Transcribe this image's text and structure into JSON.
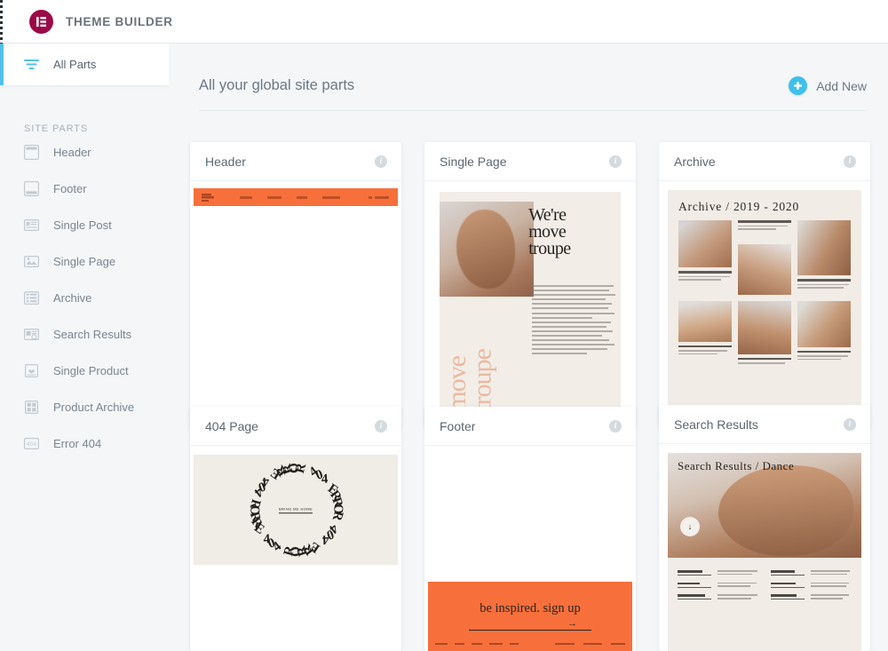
{
  "topbar": {
    "app_title": "THEME BUILDER",
    "logo_icon": "elementor-logo-icon",
    "logo_color": "#9b0a46"
  },
  "sidebar": {
    "active_item": {
      "label": "All Parts",
      "icon": "filter-icon",
      "accent": "#52c1ea"
    },
    "section_label": "SITE PARTS",
    "items": [
      {
        "label": "Header",
        "icon": "header-layout-icon"
      },
      {
        "label": "Footer",
        "icon": "footer-layout-icon"
      },
      {
        "label": "Single Post",
        "icon": "single-post-icon"
      },
      {
        "label": "Single Page",
        "icon": "single-page-icon"
      },
      {
        "label": "Archive",
        "icon": "archive-list-icon"
      },
      {
        "label": "Search Results",
        "icon": "search-results-icon"
      },
      {
        "label": "Single Product",
        "icon": "single-product-icon"
      },
      {
        "label": "Product Archive",
        "icon": "product-archive-icon"
      },
      {
        "label": "Error 404",
        "icon": "error-404-icon"
      }
    ]
  },
  "main": {
    "page_title": "All your global site parts",
    "add_new_label": "Add New",
    "add_new_icon": "plus-circle-icon",
    "add_new_color": "#3fc0ec",
    "info_icon_glyph": "i"
  },
  "cards": {
    "header": {
      "title": "Header"
    },
    "single_page": {
      "title": "Single Page",
      "preview": {
        "heading": "We're\nmove\ntroupe",
        "vertical_text": "move\ntroupe"
      }
    },
    "archive": {
      "title": "Archive",
      "preview": {
        "heading": "Archive  /  2019 - 2020"
      }
    },
    "page_404": {
      "title": "404 Page",
      "preview": {
        "ring_text": "ERROR 404 ERROR 404 ERROR 404 ERROR 404 ",
        "button_label": "BRING ME HOME"
      }
    },
    "footer": {
      "title": "Footer",
      "preview": {
        "cta": "be inspired. sign up",
        "arrow": "→",
        "accent": "#f7703c"
      }
    },
    "search_results": {
      "title": "Search Results",
      "preview": {
        "heading": "Search Results  /  Dance",
        "scroll_glyph": "↓"
      }
    }
  }
}
